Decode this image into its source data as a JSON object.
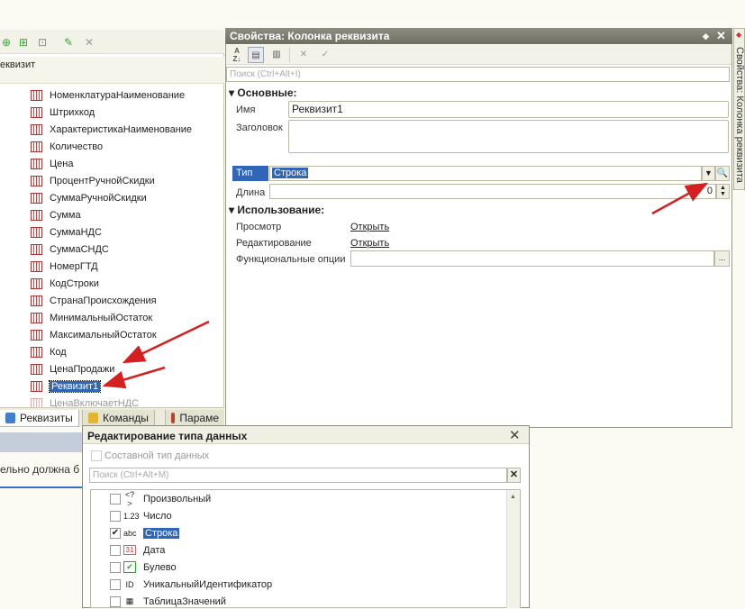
{
  "left_panel": {
    "caption": "еквизит",
    "items": [
      {
        "label": "НоменклатураНаименование"
      },
      {
        "label": "Штрихкод"
      },
      {
        "label": "ХарактеристикаНаименование"
      },
      {
        "label": "Количество"
      },
      {
        "label": "Цена"
      },
      {
        "label": "ПроцентРучнойСкидки"
      },
      {
        "label": "СуммаРучнойСкидки"
      },
      {
        "label": "Сумма"
      },
      {
        "label": "СуммаНДС"
      },
      {
        "label": "СуммаСНДС"
      },
      {
        "label": "НомерГТД"
      },
      {
        "label": "КодСтроки"
      },
      {
        "label": "СтранаПроисхождения"
      },
      {
        "label": "МинимальныйОстаток"
      },
      {
        "label": "МаксимальныйОстаток"
      },
      {
        "label": "Код"
      },
      {
        "label": "ЦенаПродажи"
      },
      {
        "label": "Реквизит1"
      },
      {
        "label": "ЦенаВключаетНДС"
      }
    ],
    "tabs": [
      {
        "label": "Реквизиты"
      },
      {
        "label": "Команды"
      },
      {
        "label": "Параме"
      }
    ],
    "lower_text": "ельно должна б"
  },
  "properties": {
    "title": "Свойства: Колонка реквизита",
    "search_placeholder": "Поиск (Ctrl+Alt+I)",
    "section_main": "Основные:",
    "name_label": "Имя",
    "name_value": "Реквизит1",
    "header_label": "Заголовок",
    "type_label": "Тип",
    "type_value": "Строка",
    "length_label": "Длина",
    "length_value": "0",
    "section_usage": "Использование:",
    "view_label": "Просмотр",
    "view_link": "Открыть",
    "edit_label": "Редактирование",
    "edit_link": "Открыть",
    "func_label": "Функциональные опции",
    "func_btn": "...",
    "side_tab": "Свойства: Колонка реквизита"
  },
  "dialog": {
    "title": "Редактирование типа данных",
    "composite_label": "Составной тип данных",
    "search_placeholder": "Поиск (Ctrl+Alt+M)",
    "types": [
      {
        "label": "Произвольный",
        "icon": "<?>",
        "checked": false
      },
      {
        "label": "Число",
        "icon": "1.23",
        "checked": false
      },
      {
        "label": "Строка",
        "icon": "abc",
        "checked": true
      },
      {
        "label": "Дата",
        "icon": "31",
        "checked": false
      },
      {
        "label": "Булево",
        "icon": "✔",
        "checked": false
      },
      {
        "label": "УникальныйИдентификатор",
        "icon": "ID",
        "checked": false
      },
      {
        "label": "ТаблицаЗначений",
        "icon": "▦",
        "checked": false
      }
    ]
  },
  "colors": {
    "selection": "#3165b8",
    "arrow": "#d42020"
  }
}
